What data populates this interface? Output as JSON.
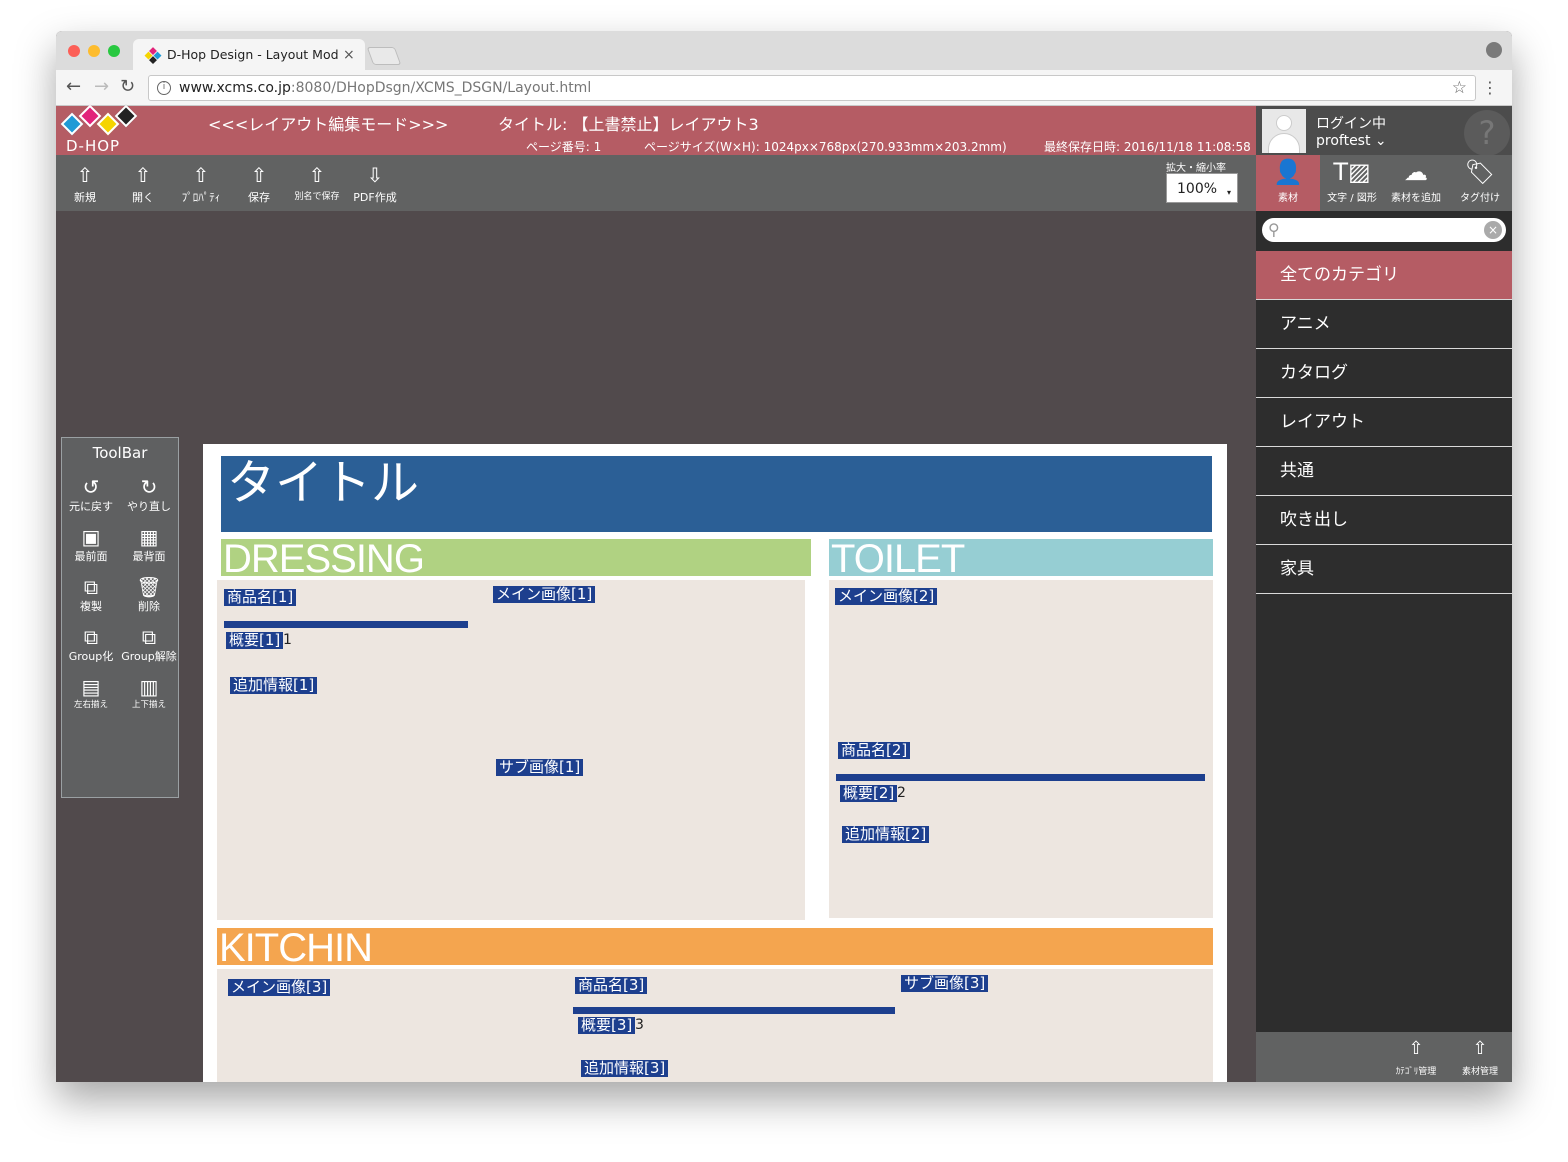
{
  "browser": {
    "tab_title": "D-Hop Design - Layout Mode",
    "tab_close": "×",
    "url_host": "www.xcms.co.jp",
    "url_path": ":8080/DHopDsgn/XCMS_DSGN/Layout.html",
    "back_glyph": "←",
    "forward_glyph": "→",
    "reload_glyph": "↻",
    "info_glyph": "i",
    "star_glyph": "☆",
    "menu_glyph": "⋮"
  },
  "header": {
    "logo_text": "D-HOP",
    "mode_title": "<<<レイアウト編集モード>>>",
    "doc_title": "タイトル: 【上書禁止】レイアウト3",
    "page_number": "ページ番号: 1",
    "page_size": "ページサイズ(W×H): 1024px×768px(270.933mm×203.2mm)",
    "last_saved": "最終保存日時: 2016/11/18 11:08:58"
  },
  "toolbar": {
    "items": [
      {
        "icon": "⇧",
        "label": "新規"
      },
      {
        "icon": "⇧",
        "label": "開く"
      },
      {
        "icon": "⇧",
        "label": "ﾌﾟﾛﾊﾟﾃｨ"
      },
      {
        "icon": "⇧",
        "label": "保存"
      },
      {
        "icon": "⇧",
        "label": "別名で保存"
      },
      {
        "icon": "⇩",
        "label": "PDF作成"
      }
    ],
    "zoom_label": "拡大・縮小率",
    "zoom_value": "100%",
    "zoom_caret": "▾"
  },
  "floating_toolbar": {
    "title": "ToolBar",
    "items": [
      {
        "icon": "↺",
        "label": "元に戻す"
      },
      {
        "icon": "↻",
        "label": "やり直し"
      },
      {
        "icon": "▣",
        "label": "最前面"
      },
      {
        "icon": "▦",
        "label": "最背面"
      },
      {
        "icon": "⧉",
        "label": "複製"
      },
      {
        "icon": "🗑",
        "label": "削除"
      },
      {
        "icon": "⧉",
        "label": "Group化"
      },
      {
        "icon": "⧉",
        "label": "Group解除"
      },
      {
        "icon": "▤",
        "label": "左右揃え"
      },
      {
        "icon": "▥",
        "label": "上下揃え"
      }
    ]
  },
  "page": {
    "title": "タイトル",
    "sections": {
      "dressing": {
        "heading": "DRESSING",
        "name": "商品名[1]",
        "summary": "概要[1]",
        "summary_trail": "1",
        "extra": "追加情報[1]",
        "main_image": "メイン画像[1]",
        "sub_image": "サブ画像[1]"
      },
      "toilet": {
        "heading": "TOILET",
        "main_image": "メイン画像[2]",
        "name": "商品名[2]",
        "summary": "概要[2]",
        "summary_trail": "2",
        "extra": "追加情報[2]"
      },
      "kitchin": {
        "heading": "KITCHIN",
        "main_image": "メイン画像[3]",
        "name": "商品名[3]",
        "summary": "概要[3]",
        "summary_trail": "3",
        "extra": "追加情報[3]",
        "sub_image": "サブ画像[3]"
      }
    },
    "colors": {
      "title": "#2b5f96",
      "dressing": "#b0d282",
      "toilet": "#96ced3",
      "kitchin": "#f4a54f",
      "placeholder": "#1d3f8e",
      "body": "#ede6e0"
    }
  },
  "sidebar": {
    "login_state": "ログイン中",
    "user_name": "proftest ⌄",
    "help_glyph": "?",
    "asset_tabs": [
      {
        "icon": "👤",
        "label": "素材"
      },
      {
        "icon": "T▨",
        "label": "文字 / 図形"
      },
      {
        "icon": "☁",
        "label": "素材を追加"
      },
      {
        "icon": "🏷",
        "label": "タグ付け"
      }
    ],
    "search_placeholder": "",
    "search_glyph": "⚲",
    "clear_glyph": "×",
    "categories": [
      "全てのカテゴリ",
      "アニメ",
      "カタログ",
      "レイアウト",
      "共通",
      "吹き出し",
      "家具"
    ],
    "bottom_buttons": [
      {
        "icon": "⇧",
        "label": "ｶﾃｺﾞﾘ管理"
      },
      {
        "icon": "⇧",
        "label": "素材管理"
      }
    ]
  }
}
